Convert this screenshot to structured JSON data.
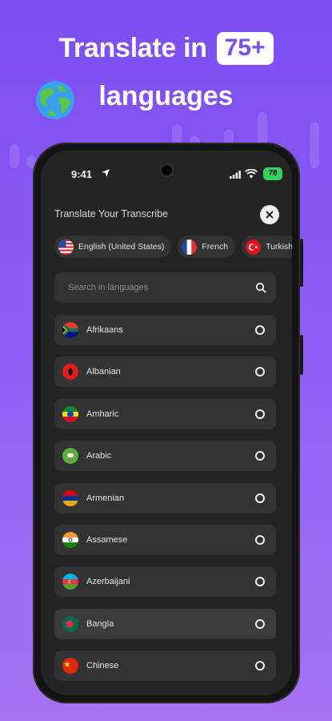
{
  "promo": {
    "headline_prefix": "Translate in",
    "headline_badge": "75+",
    "headline_suffix": "languages"
  },
  "status_bar": {
    "time": "9:41",
    "battery": "78"
  },
  "panel": {
    "title": "Translate Your Transcribe"
  },
  "selected_languages": [
    {
      "label": "English (United States)",
      "flag": "us-flag-icon"
    },
    {
      "label": "French",
      "flag": "france-flag-icon"
    },
    {
      "label": "Turkish",
      "flag": "turkey-flag-icon"
    }
  ],
  "search": {
    "placeholder": "Search in languages"
  },
  "languages": [
    {
      "label": "Afrikaans",
      "flag": "south-africa-flag-icon",
      "selected": false
    },
    {
      "label": "Albanian",
      "flag": "albania-flag-icon",
      "selected": false
    },
    {
      "label": "Amharic",
      "flag": "ethiopia-flag-icon",
      "selected": false
    },
    {
      "label": "Arabic",
      "flag": "arabic-flag-icon",
      "selected": false
    },
    {
      "label": "Armenian",
      "flag": "armenia-flag-icon",
      "selected": false
    },
    {
      "label": "Assamese",
      "flag": "india-flag-icon",
      "selected": false
    },
    {
      "label": "Azerbaijani",
      "flag": "azerbaijan-flag-icon",
      "selected": false
    },
    {
      "label": "Bangla",
      "flag": "bangladesh-flag-icon",
      "selected": true
    },
    {
      "label": "Chinese",
      "flag": "china-flag-icon",
      "selected": false
    }
  ],
  "colors": {
    "background_top": "#7c4df2",
    "background_bottom": "#a773f3",
    "badge_text": "#7c4df2",
    "panel": "#242424",
    "row": "#333333"
  }
}
